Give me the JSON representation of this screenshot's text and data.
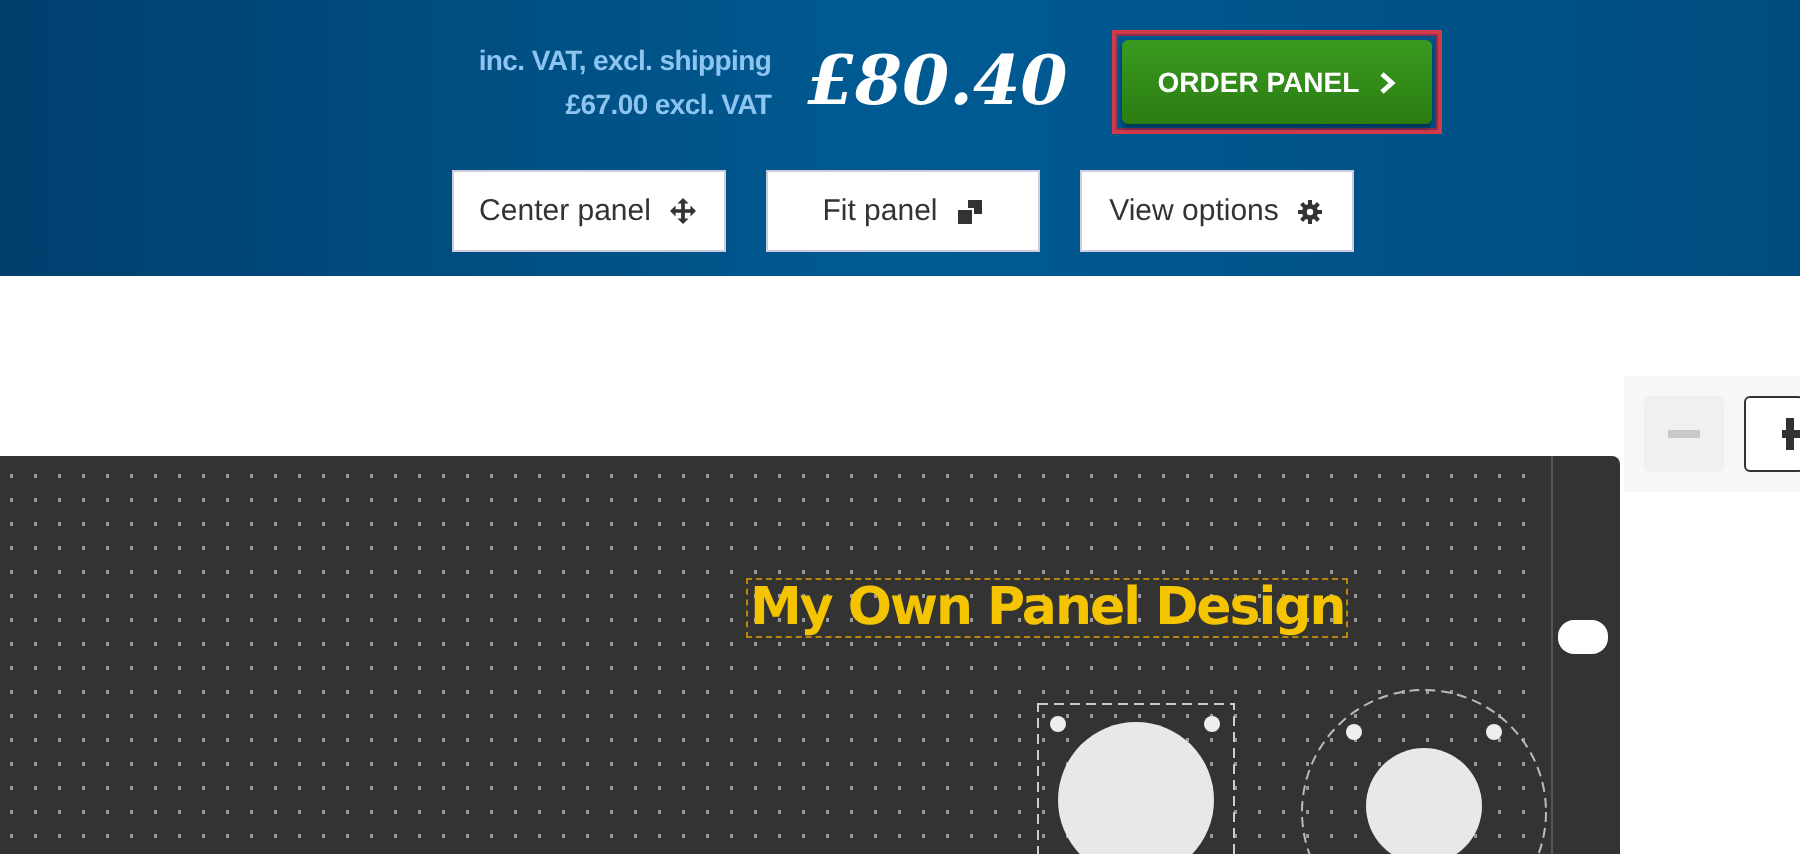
{
  "price": {
    "note": "inc. VAT, excl. shipping",
    "excl_vat": "£67.00 excl. VAT",
    "total": "£80.40"
  },
  "order_button": {
    "label": "ORDER PANEL",
    "focused": true
  },
  "toolbar": [
    {
      "label": "Center panel",
      "kind": "move"
    },
    {
      "label": "Fit panel",
      "kind": "fit"
    },
    {
      "label": "View options",
      "kind": "gear"
    }
  ],
  "zoom": [
    {
      "kind": "minus",
      "disabled": true
    },
    {
      "kind": "plus",
      "disabled": false
    }
  ],
  "panel": {
    "title": "My Own Panel Design",
    "title_selected": true
  }
}
